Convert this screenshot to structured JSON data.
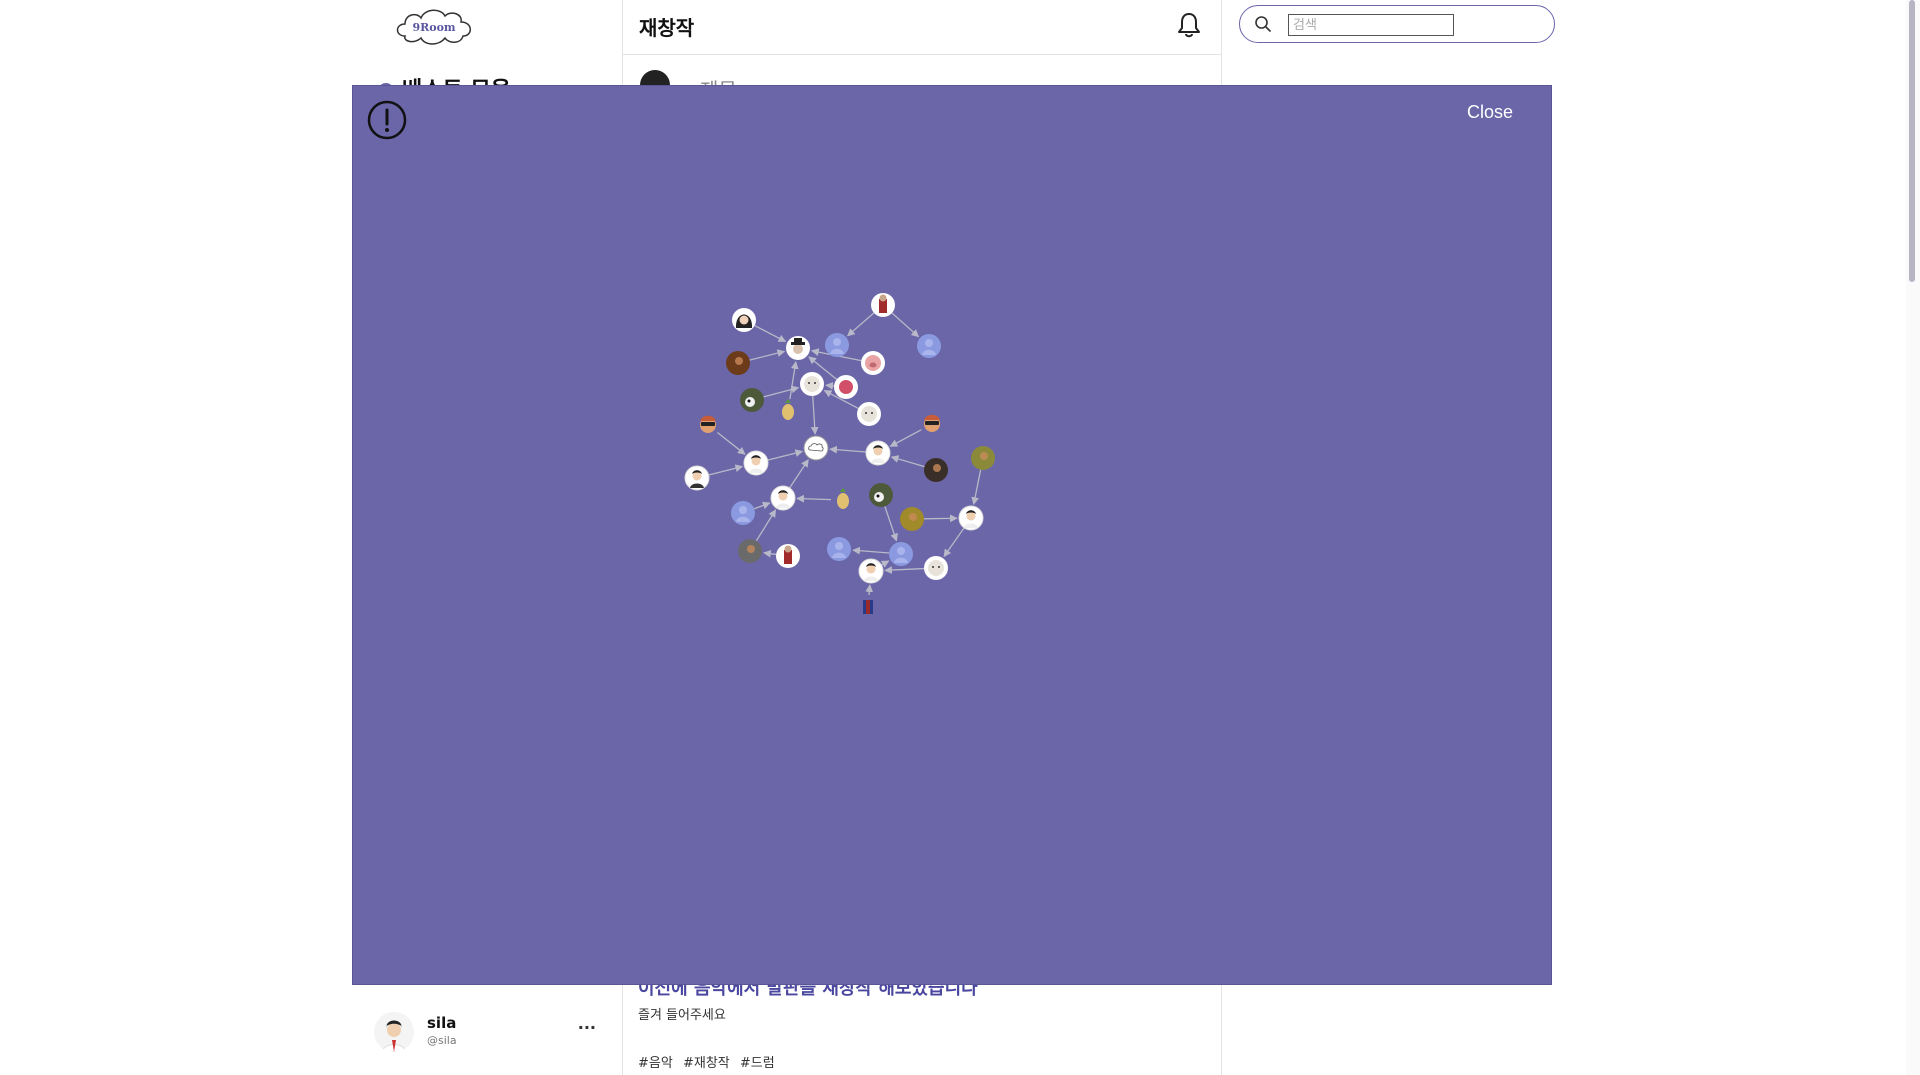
{
  "app": {
    "logo_text": "9Room"
  },
  "left_nav": {
    "partial_item_label": "베스트 모음"
  },
  "main": {
    "page_title": "재창작",
    "post_author_partial": "제목"
  },
  "search": {
    "placeholder": "검색"
  },
  "post": {
    "title": "이전에 음악에서 발판을 재창작 해보았습니다",
    "body": "즐겨 들어주세요",
    "tags": [
      "#음악",
      "#재창작",
      "#드럼"
    ]
  },
  "user": {
    "name": "sila",
    "handle": "@sila",
    "more_label": "···"
  },
  "modal": {
    "close_label": "Close"
  },
  "graph": {
    "nodes": [
      {
        "id": "n1",
        "kind": "woman",
        "color": "#2b2b2b"
      },
      {
        "id": "n2",
        "kind": "pirate",
        "color": "#c8a58a"
      },
      {
        "id": "n3",
        "kind": "default",
        "color": "#8b9ae0"
      },
      {
        "id": "n4",
        "kind": "default",
        "color": "#8b9ae0"
      },
      {
        "id": "n5",
        "kind": "portrait",
        "color": "#6b3b1a"
      },
      {
        "id": "n6",
        "kind": "hat-man",
        "color": "#3a3a3a"
      },
      {
        "id": "n7",
        "kind": "pig",
        "color": "#e9a3a5"
      },
      {
        "id": "n8",
        "kind": "bear",
        "color": "#e7e3da"
      },
      {
        "id": "n9",
        "kind": "blob",
        "color": "#d24f6a"
      },
      {
        "id": "n10",
        "kind": "panda",
        "color": "#4d5a3a"
      },
      {
        "id": "n11",
        "kind": "chick",
        "color": "#e1c170"
      },
      {
        "id": "n12",
        "kind": "bear",
        "color": "#e7e3da"
      },
      {
        "id": "n13",
        "kind": "sunglasses",
        "color": "#c75c3a"
      },
      {
        "id": "n14",
        "kind": "sunglasses",
        "color": "#c75c3a"
      },
      {
        "id": "n15",
        "kind": "logo",
        "color": "#ffffff"
      },
      {
        "id": "n16",
        "kind": "boy",
        "color": "#2b2b2b"
      },
      {
        "id": "n17",
        "kind": "boy",
        "color": "#2b2b2b"
      },
      {
        "id": "n18",
        "kind": "suit",
        "color": "#2b2b2b"
      },
      {
        "id": "n19",
        "kind": "portrait",
        "color": "#3a2e28"
      },
      {
        "id": "n20",
        "kind": "green",
        "color": "#8a8a3a"
      },
      {
        "id": "n21",
        "kind": "boy",
        "color": "#2b2b2b"
      },
      {
        "id": "n22",
        "kind": "chick",
        "color": "#e1c170"
      },
      {
        "id": "n23",
        "kind": "panda",
        "color": "#4d5a3a"
      },
      {
        "id": "n24",
        "kind": "default",
        "color": "#8b9ae0"
      },
      {
        "id": "n25",
        "kind": "green",
        "color": "#a08a2a"
      },
      {
        "id": "n26",
        "kind": "boy",
        "color": "#2b2b2b"
      },
      {
        "id": "n27",
        "kind": "gray",
        "color": "#6a6a6a"
      },
      {
        "id": "n28",
        "kind": "pirate",
        "color": "#c8a58a"
      },
      {
        "id": "n29",
        "kind": "default",
        "color": "#8b9ae0"
      },
      {
        "id": "n30",
        "kind": "default",
        "color": "#8b9ae0"
      },
      {
        "id": "n31",
        "kind": "boy",
        "color": "#2b2b2b"
      },
      {
        "id": "n32",
        "kind": "bear",
        "color": "#e7e3da"
      },
      {
        "id": "n33",
        "kind": "jersey",
        "color": "#9a2a2a"
      }
    ],
    "edges": [
      [
        "n1",
        "n6"
      ],
      [
        "n2",
        "n3"
      ],
      [
        "n2",
        "n4"
      ],
      [
        "n5",
        "n6"
      ],
      [
        "n7",
        "n6"
      ],
      [
        "n9",
        "n6"
      ],
      [
        "n10",
        "n8"
      ],
      [
        "n9",
        "n8"
      ],
      [
        "n12",
        "n8"
      ],
      [
        "n11",
        "n6"
      ],
      [
        "n8",
        "n15"
      ],
      [
        "n13",
        "n16"
      ],
      [
        "n16",
        "n15"
      ],
      [
        "n18",
        "n16"
      ],
      [
        "n14",
        "n17"
      ],
      [
        "n17",
        "n15"
      ],
      [
        "n19",
        "n17"
      ],
      [
        "n21",
        "n15"
      ],
      [
        "n22",
        "n21"
      ],
      [
        "n24",
        "n21"
      ],
      [
        "n27",
        "n21"
      ],
      [
        "n28",
        "n27"
      ],
      [
        "n20",
        "n26"
      ],
      [
        "n25",
        "n26"
      ],
      [
        "n23",
        "n30"
      ],
      [
        "n30",
        "n29"
      ],
      [
        "n31",
        "n30"
      ],
      [
        "n32",
        "n31"
      ],
      [
        "n26",
        "n32"
      ],
      [
        "n33",
        "n31"
      ]
    ]
  }
}
